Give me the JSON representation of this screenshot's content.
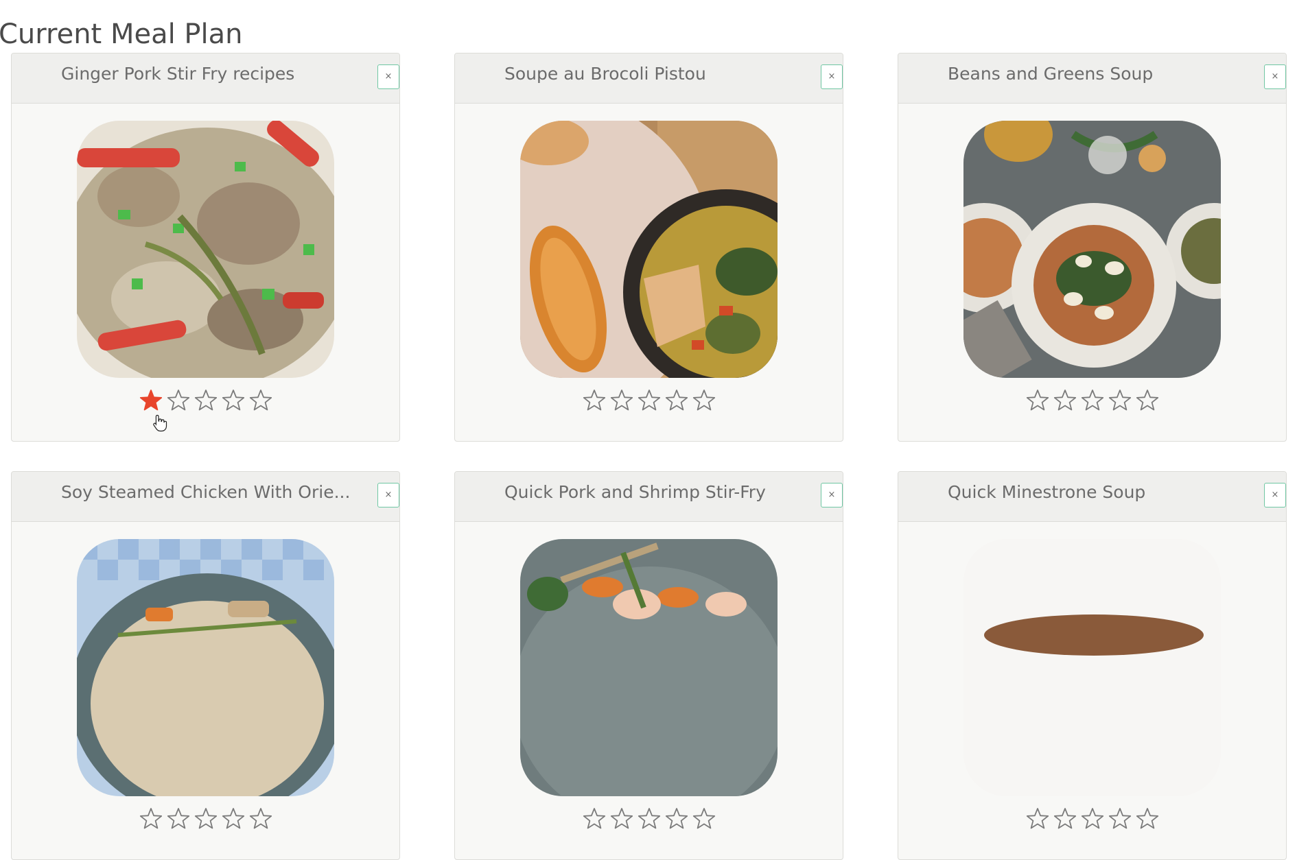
{
  "page": {
    "title": "Current Meal Plan"
  },
  "colors": {
    "accent_border": "#6fc7a3",
    "star_filled": "#e8452c",
    "star_empty_stroke": "#7a7a7a",
    "title_text": "#4a4a4a",
    "card_title_text": "#6b6b6b"
  },
  "icons": {
    "remove": "close-icon",
    "star": "star-icon",
    "cursor": "hand-pointer-icon"
  },
  "meals": [
    {
      "title": "Ginger Pork Stir Fry recipes",
      "remove_label": "×",
      "rating": 1,
      "max_rating": 5,
      "photo": "ginger-pork-stir-fry"
    },
    {
      "title": "Soupe au Brocoli Pistou",
      "remove_label": "×",
      "rating": 0,
      "max_rating": 5,
      "photo": "soupe-au-brocoli-pistou"
    },
    {
      "title": "Beans and Greens Soup",
      "remove_label": "×",
      "rating": 0,
      "max_rating": 5,
      "photo": "beans-and-greens-soup"
    },
    {
      "title": "Soy Steamed Chicken With Orie...",
      "remove_label": "×",
      "rating": 0,
      "max_rating": 5,
      "photo": "soy-steamed-chicken"
    },
    {
      "title": "Quick Pork and Shrimp Stir-Fry",
      "remove_label": "×",
      "rating": 0,
      "max_rating": 5,
      "photo": "quick-pork-shrimp-stir-fry"
    },
    {
      "title": "Quick Minestrone Soup",
      "remove_label": "×",
      "rating": 0,
      "max_rating": 5,
      "photo": "quick-minestrone-soup"
    }
  ]
}
